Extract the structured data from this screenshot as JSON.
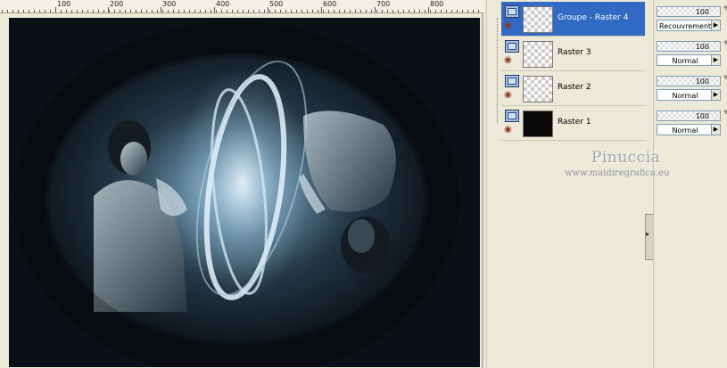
{
  "ruler": {
    "labels": [
      "100",
      "200",
      "300",
      "400",
      "500",
      "600",
      "700",
      "800"
    ]
  },
  "layers": [
    {
      "name": "Groupe - Raster 4",
      "opacity": "100",
      "blend_mode": "Recouvrement",
      "selected": true
    },
    {
      "name": "Raster 3",
      "opacity": "100",
      "blend_mode": "Normal",
      "selected": false
    },
    {
      "name": "Raster 2",
      "opacity": "100",
      "blend_mode": "Normal",
      "selected": false
    },
    {
      "name": "Raster 1",
      "opacity": "100",
      "blend_mode": "Normal",
      "selected": false
    }
  ],
  "watermark": {
    "name": "Pinuccia",
    "url": "www.maidiregrafica.eu"
  },
  "colors": {
    "selection": "#316ac5",
    "canvas_bg": "#0d1117",
    "panel_bg": "#ece9d8"
  },
  "icons": {
    "layer_visibility": "eye-icon",
    "layer_type": "raster-layer-icon"
  }
}
